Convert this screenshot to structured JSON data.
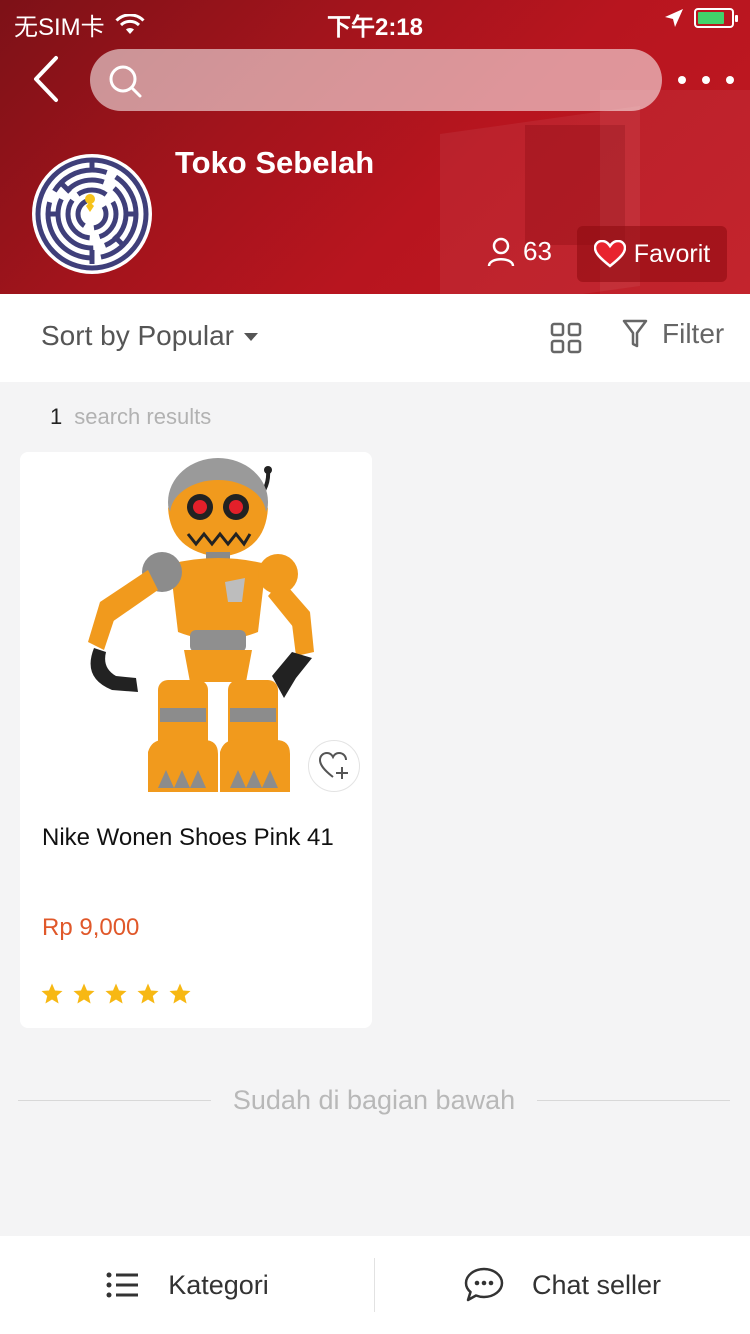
{
  "status_bar": {
    "carrier": "无SIM卡",
    "time": "下午2:18"
  },
  "header": {
    "search_placeholder": "",
    "shop_name": "Toko Sebelah",
    "followers": "63",
    "favorite_label": "Favorit",
    "accent_color": "#b8151f"
  },
  "sort_bar": {
    "sort_label": "Sort by Popular",
    "filter_label": "Filter"
  },
  "results": {
    "count": "1",
    "label": "search results"
  },
  "products": [
    {
      "title": "Nike Wonen Shoes Pink 41",
      "price": "Rp 9,000",
      "rating": 5,
      "image_icon": "orange-robot-toy"
    }
  ],
  "bottom_note": "Sudah di bagian bawah",
  "bottom_bar": {
    "category_label": "Kategori",
    "chat_label": "Chat seller"
  }
}
